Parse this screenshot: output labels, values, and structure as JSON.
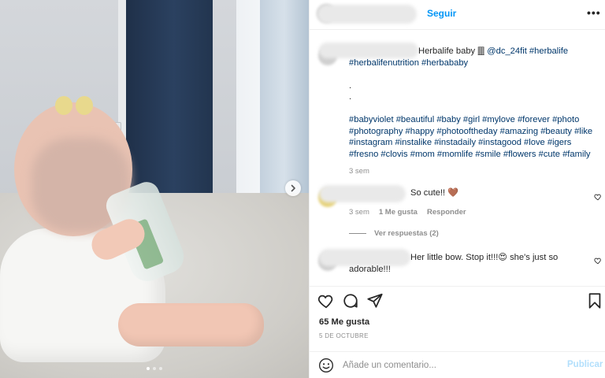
{
  "post": {
    "follow_label": "Seguir",
    "more_label": "•••",
    "caption": {
      "line1_text": "Herbalife baby 🀫 ",
      "line1_mention": "@dc_24fit",
      "line1_tag": "#herbalife",
      "line2": "#herbalifenutrition #herbababy",
      "dot1": ".",
      "dot2": ".",
      "hashtags": [
        "#babyviolet #beautiful #baby #girl #mylove #forever #photo",
        "#photography #happy #photooftheday #amazing #beauty #like",
        "#instagram #instalike #instadaily #instagood #love #igers",
        "#fresno #clovis #mom #momlife #smile #flowers #cute #family"
      ],
      "time": "3 sem"
    },
    "comments": [
      {
        "text": "So cute!! 🤎",
        "time": "3 sem",
        "likes": "1 Me gusta",
        "reply": "Responder",
        "view_replies": "Ver respuestas (2)"
      },
      {
        "text_line1": "Her little bow. Stop it!!!😍 she's just so",
        "text_line2": "adorable!!!"
      }
    ],
    "likes": "65 Me gusta",
    "date": "5 DE OCTUBRE",
    "composer": {
      "placeholder": "Añade un comentario...",
      "publish": "Publicar"
    },
    "carousel": {
      "slides": 3,
      "active": 0
    }
  },
  "icons": {
    "more": "more-dots-icon",
    "heart": "heart-icon",
    "comment": "comment-icon",
    "share": "share-icon",
    "save": "bookmark-icon",
    "emoji": "emoji-icon",
    "next": "chevron-right-icon"
  },
  "colors": {
    "link": "#00376b",
    "accent": "#0095f6",
    "publish_disabled": "#b2dffc",
    "muted": "#8e8e8e"
  }
}
